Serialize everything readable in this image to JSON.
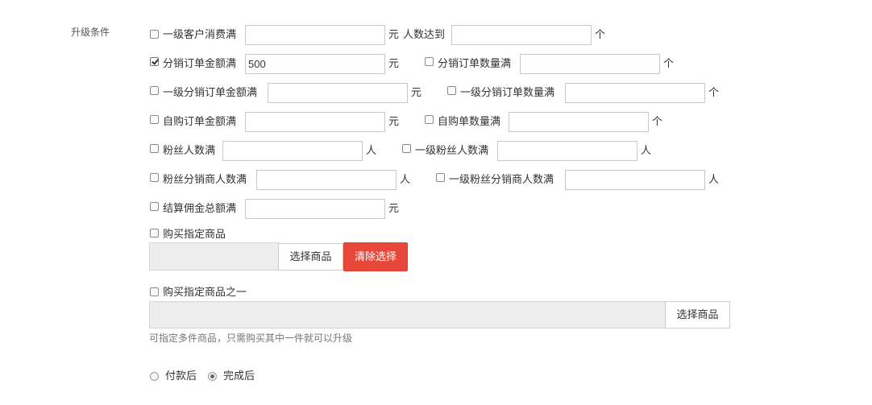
{
  "section_label": "升级条件",
  "conditions": {
    "customer_spend": {
      "label": "一级客户消费满",
      "value": "",
      "unit": "元",
      "checked": false
    },
    "people_reach": {
      "label": "人数达到",
      "value": "",
      "unit": "个"
    },
    "dist_order_amount": {
      "label": "分销订单金额满",
      "value": "500",
      "unit": "元",
      "checked": true
    },
    "dist_order_count": {
      "label": "分销订单数量满",
      "value": "",
      "unit": "个",
      "checked": false
    },
    "l1_dist_order_amount": {
      "label": "一级分销订单金额满",
      "value": "",
      "unit": "元",
      "checked": false
    },
    "l1_dist_order_count": {
      "label": "一级分销订单数量满",
      "value": "",
      "unit": "个",
      "checked": false
    },
    "self_order_amount": {
      "label": "自购订单金额满",
      "value": "",
      "unit": "元",
      "checked": false
    },
    "self_order_count": {
      "label": "自购单数量满",
      "value": "",
      "unit": "个",
      "checked": false
    },
    "fans_count": {
      "label": "粉丝人数满",
      "value": "",
      "unit": "人",
      "checked": false
    },
    "l1_fans_count": {
      "label": "一级粉丝人数满",
      "value": "",
      "unit": "人",
      "checked": false
    },
    "fans_dist_count": {
      "label": "粉丝分销商人数满",
      "value": "",
      "unit": "人",
      "checked": false
    },
    "l1_fans_dist_count": {
      "label": "一级粉丝分销商人数满",
      "value": "",
      "unit": "人",
      "checked": false
    },
    "commission_total": {
      "label": "结算佣金总额满",
      "value": "",
      "unit": "元",
      "checked": false
    }
  },
  "buy_specific": {
    "label": "购买指定商品",
    "checked": false,
    "select_button": "选择商品",
    "clear_button": "清除选择"
  },
  "buy_one_of": {
    "label": "购买指定商品之一",
    "checked": false,
    "select_button": "选择商品",
    "hint": "可指定多件商品，只需购买其中一件就可以升级"
  },
  "timing": {
    "options": [
      {
        "label": "付款后",
        "selected": false
      },
      {
        "label": "完成后",
        "selected": true
      }
    ]
  },
  "colors": {
    "danger_button": "#e8483a"
  }
}
